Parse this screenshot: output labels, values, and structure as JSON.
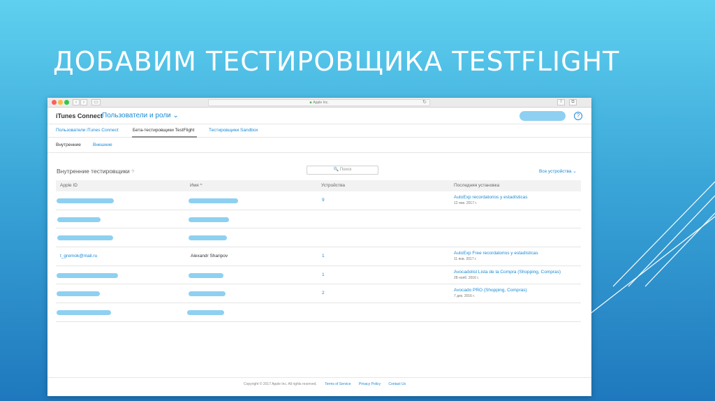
{
  "slide": {
    "title": "ДОБАВИМ ТЕСТИРОВЩИКА TESTFLIGHT"
  },
  "browser": {
    "address": "Apple Inc.",
    "nav_back": "‹",
    "nav_forward": "›",
    "sidebar_glyph": "▭",
    "reload_glyph": "↻",
    "share_glyph": "⇧",
    "tabs_glyph": "⧉"
  },
  "app": {
    "brand": "iTunes Connect",
    "section_menu": "Пользователи и роли ⌄",
    "help_glyph": "?"
  },
  "tabs": [
    {
      "label": "Пользователи iTunes Connect"
    },
    {
      "label": "Бета-тестировщики TestFlight"
    },
    {
      "label": "Тестировщики Sandbox"
    }
  ],
  "subtabs": [
    {
      "label": "Внутренние"
    },
    {
      "label": "Внешние"
    }
  ],
  "section": {
    "title": "Внутренние тестировщики",
    "help": "?",
    "search_placeholder": "🔍 Поиск",
    "filter": "Все устройства ⌄"
  },
  "table": {
    "columns": [
      "Apple ID",
      "Имя ^",
      "Устройства",
      "Последняя установка"
    ],
    "rows": [
      {
        "apple_id": "",
        "name": "",
        "devices": "9",
        "last_app": "AutoExp recordatorios y estadísticas",
        "last_date": "12 янв. 2017 г."
      },
      {
        "apple_id": "",
        "name": "",
        "devices": "",
        "last_app": "",
        "last_date": ""
      },
      {
        "apple_id": "",
        "name": "",
        "devices": "",
        "last_app": "",
        "last_date": ""
      },
      {
        "apple_id": "t_gremok@mail.ru",
        "name": "Alexandr Sharipov",
        "devices": "1",
        "last_app": "AutoExp Free recordatorios y estadísticas",
        "last_date": "11 янв. 2017 г."
      },
      {
        "apple_id": "",
        "name": "",
        "devices": "1",
        "last_app": "Avocadolist Lista de la Compra (Shopping, Compras)",
        "last_date": "28 нояб. 2016 г."
      },
      {
        "apple_id": "",
        "name": "",
        "devices": "2",
        "last_app": "Avocado PRO (Shopping, Compras)",
        "last_date": "7 дек. 2016 г."
      },
      {
        "apple_id": "",
        "name": "",
        "devices": "",
        "last_app": "",
        "last_date": ""
      }
    ]
  },
  "footer": {
    "copyright": "Copyright © 2017 Apple Inc. All rights reserved.",
    "terms": "Terms of Service",
    "privacy": "Privacy Policy",
    "contact": "Contact Us"
  }
}
